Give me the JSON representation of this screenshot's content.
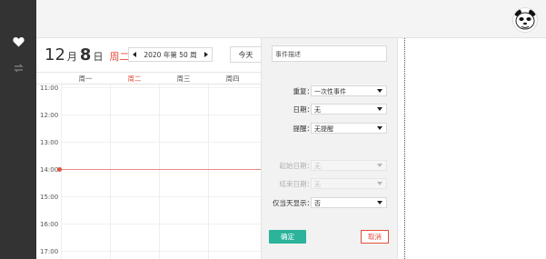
{
  "calendar": {
    "month": "12",
    "month_unit": "月",
    "day": "8",
    "day_unit": "日",
    "weekday": "周二",
    "week_label": "2020 年第 50 周",
    "today_label": "今天",
    "weekdays": [
      "周一",
      "周二",
      "周三",
      "周四"
    ],
    "active_weekday": "周二",
    "times": [
      "11:00",
      "12:00",
      "13:00",
      "14:00",
      "15:00",
      "16:00",
      "17:00"
    ],
    "current_time": "14:00"
  },
  "event_panel": {
    "description_placeholder": "事件描述",
    "repeat_label": "重复：",
    "repeat_value": "一次性事件",
    "date_label": "日期：",
    "date_value": "无",
    "reminder_label": "提醒：",
    "reminder_value": "无提醒",
    "start_date_label": "起始日期：",
    "start_date_value": "无",
    "end_date_label": "结束日期：",
    "end_date_value": "无",
    "daytime_only_label": "仅当天显示：",
    "daytime_only_value": "否",
    "confirm_label": "确定",
    "cancel_label": "取消"
  },
  "sidebar": {
    "icons": [
      "heart-icon",
      "sync-arrows-icon"
    ]
  },
  "header": {
    "avatar": "panda-avatar"
  },
  "colors": {
    "accent_red": "#e64c3c",
    "confirm_green": "#2bb39b",
    "sidebar_bg": "#333333"
  }
}
